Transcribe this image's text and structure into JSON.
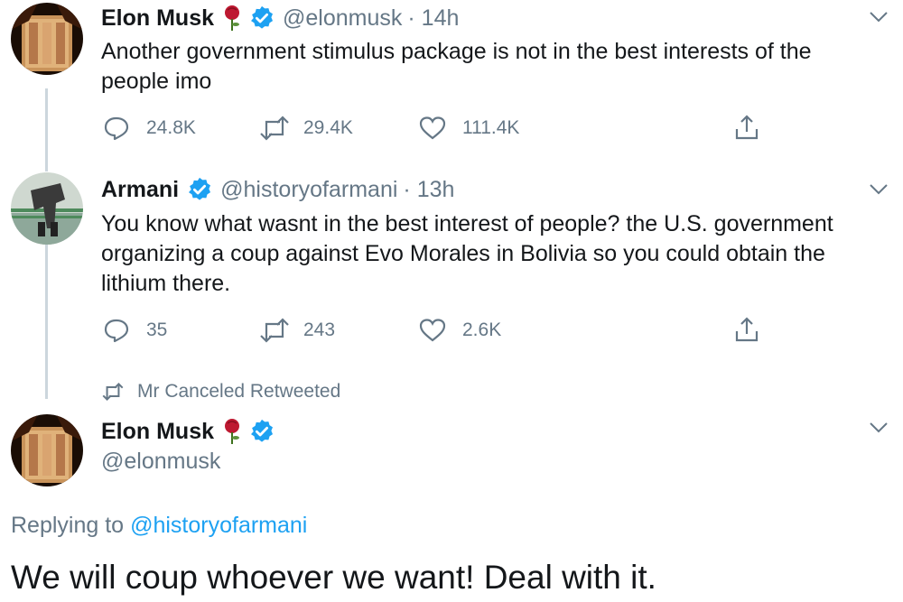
{
  "tweets": [
    {
      "name": "Elon Musk",
      "handle": "@elonmusk",
      "time": "· 14h",
      "text": "Another government stimulus package is not in the best interests of the people imo",
      "replies": "24.8K",
      "retweets": "29.4K",
      "likes": "111.4K"
    },
    {
      "name": "Armani",
      "handle": "@historyofarmani",
      "time": "· 13h",
      "text": "You know what wasnt in the best interest of people? the U.S. government organizing a coup against Evo Morales in Bolivia so you could obtain the lithium there.",
      "replies": "35",
      "retweets": "243",
      "likes": "2.6K"
    }
  ],
  "retweet_context": "Mr Canceled Retweeted",
  "main_tweet": {
    "name": "Elon Musk",
    "handle": "@elonmusk",
    "replying_prefix": "Replying to",
    "replying_to": "@historyofarmani",
    "text": "We will coup whoever we want! Deal with it."
  },
  "colors": {
    "link": "#1da1f2",
    "secondary_text": "#657786",
    "verified": "#1da1f2",
    "thread_line": "#ccd6dd"
  }
}
